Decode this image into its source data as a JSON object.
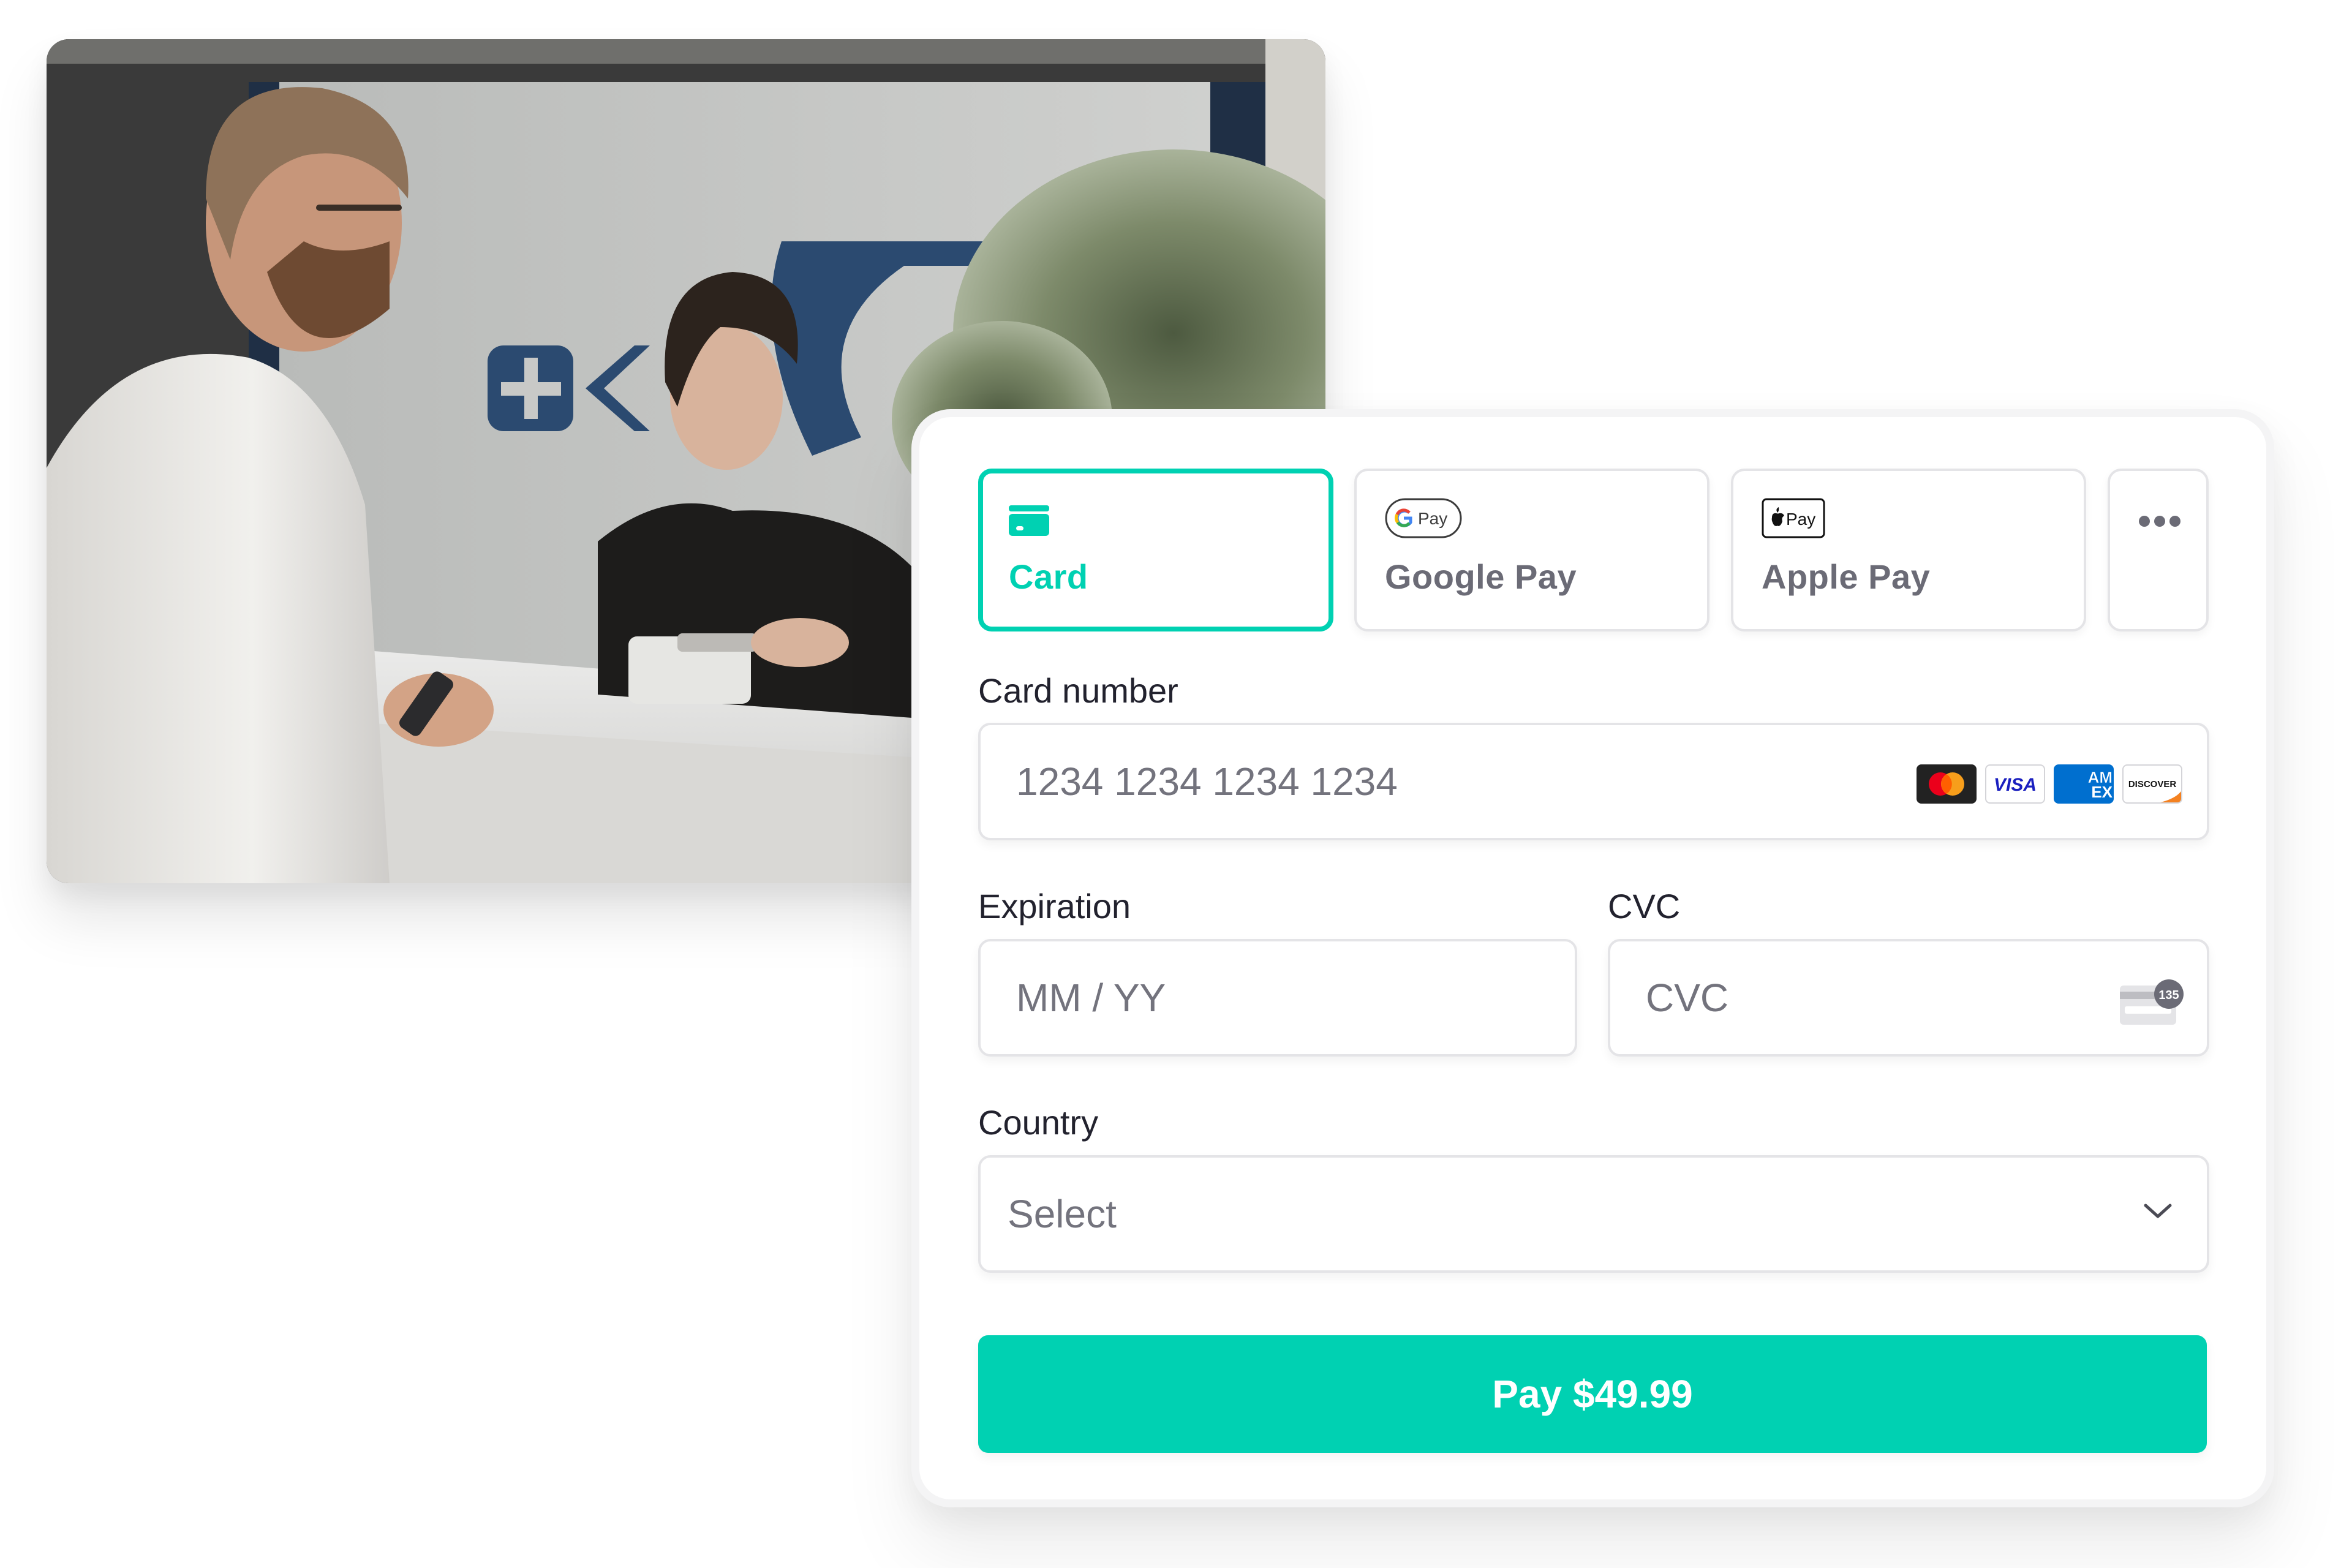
{
  "photo": {
    "description": "Customer holding a phone at a reception desk while a staff member taps a card terminal"
  },
  "payment_methods": {
    "selected": "card",
    "tabs": [
      {
        "id": "card",
        "label": "Card",
        "icon": "credit-card-icon"
      },
      {
        "id": "google_pay",
        "label": "Google Pay",
        "icon": "google-pay-logo",
        "logo_text": "Pay"
      },
      {
        "id": "apple_pay",
        "label": "Apple Pay",
        "icon": "apple-pay-logo",
        "logo_text": "Pay"
      },
      {
        "id": "more",
        "label": "",
        "icon": "more-horizontal-icon"
      }
    ]
  },
  "form": {
    "card_number": {
      "label": "Card number",
      "placeholder": "1234 1234 1234 1234",
      "value": "",
      "brands": [
        {
          "name": "Mastercard",
          "icon": "mastercard-logo"
        },
        {
          "name": "Visa",
          "icon": "visa-logo",
          "text": "VISA"
        },
        {
          "name": "American Express",
          "icon": "amex-logo",
          "text_top": "AM",
          "text_bottom": "EX"
        },
        {
          "name": "Discover",
          "icon": "discover-logo",
          "text": "DISCOVER"
        }
      ]
    },
    "expiration": {
      "label": "Expiration",
      "placeholder": "MM / YY",
      "value": ""
    },
    "cvc": {
      "label": "CVC",
      "placeholder": "CVC",
      "value": "",
      "hint_icon": "cvc-card-icon",
      "hint_badge": "135"
    },
    "country": {
      "label": "Country",
      "selected": "Select",
      "icon": "chevron-down-icon"
    }
  },
  "pay_button": {
    "label": "Pay $49.99",
    "amount": "$49.99"
  },
  "colors": {
    "accent": "#00d1b2",
    "label_text": "#22222e",
    "placeholder_text": "#73737d",
    "border": "#e4e4e7"
  }
}
